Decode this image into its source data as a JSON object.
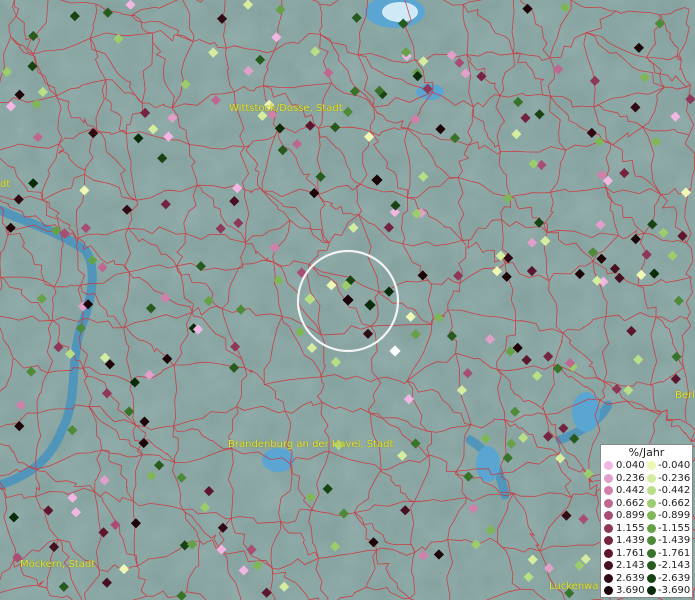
{
  "map": {
    "places": [
      {
        "name": "Wittstock/Dosse, Stadt"
      },
      {
        "name": "Brandenburg an der Havel, Stadt"
      },
      {
        "name": "Möckern, Stadt"
      },
      {
        "name": "Luckenwa"
      },
      {
        "name": "Berl"
      },
      {
        "name": "dt"
      }
    ]
  },
  "legend": {
    "title": "%/Jahr",
    "positive": [
      "0.040",
      "0.236",
      "0.442",
      "0.662",
      "0.899",
      "1.155",
      "1.439",
      "1.761",
      "2.143",
      "2.639",
      "3.690"
    ],
    "negative": [
      "-0.040",
      "-0.236",
      "-0.442",
      "-0.662",
      "-0.899",
      "-1.155",
      "-1.439",
      "-1.761",
      "-2.143",
      "-2.639",
      "-3.690"
    ],
    "positive_colors": [
      "#f2b6e3",
      "#e29fc9",
      "#d080aa",
      "#be6891",
      "#a84e74",
      "#8e3858",
      "#742440",
      "#5c162e",
      "#461020",
      "#320a14",
      "#1c0408"
    ],
    "negative_colors": [
      "#eff7b4",
      "#d6eda0",
      "#b9de85",
      "#9ccd6c",
      "#7fb757",
      "#66a147",
      "#4e8a37",
      "#39732a",
      "#275b1e",
      "#184414",
      "#0b2c0a"
    ]
  }
}
